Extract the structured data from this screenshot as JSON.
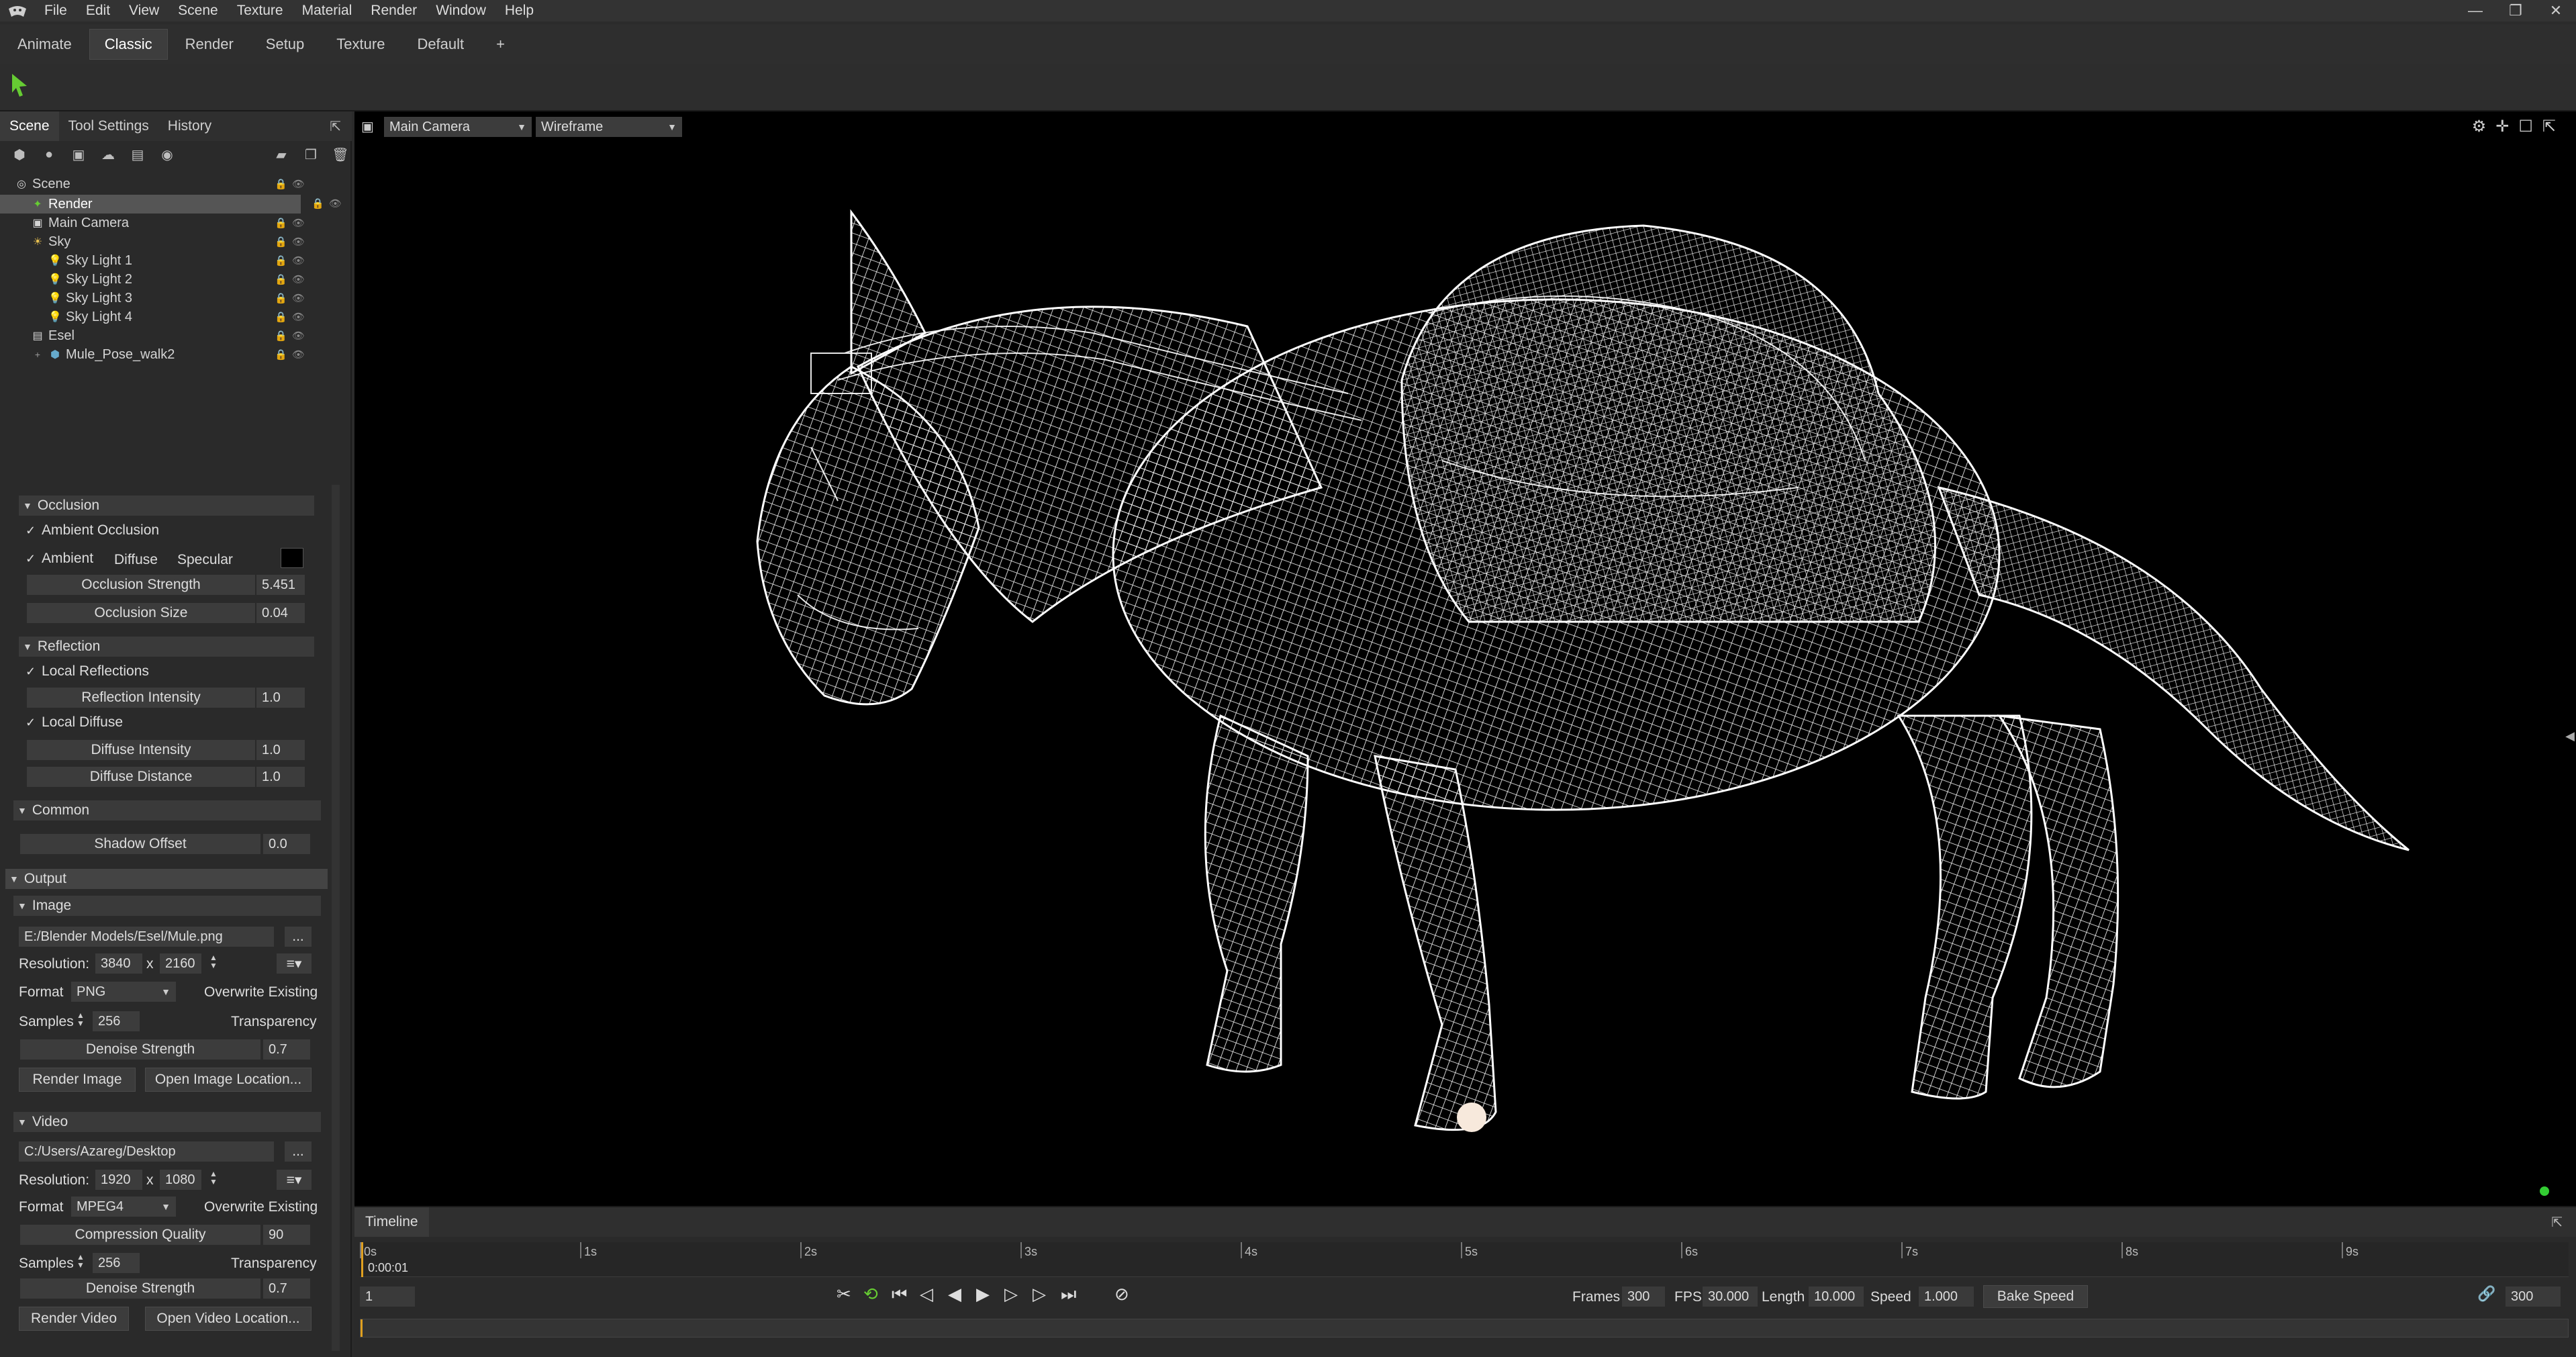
{
  "menubar": {
    "items": [
      "File",
      "Edit",
      "View",
      "Scene",
      "Texture",
      "Material",
      "Render",
      "Window",
      "Help"
    ],
    "window_buttons": [
      "—",
      "❐",
      "✕"
    ]
  },
  "workspace_tabs": [
    "Animate",
    "Classic",
    "Render",
    "Setup",
    "Texture",
    "Default",
    "+"
  ],
  "panel": {
    "tabs": [
      "Scene",
      "Tool Settings",
      "History"
    ]
  },
  "tree": [
    {
      "label": "Scene",
      "icon": "scene-icon"
    },
    {
      "label": "Render",
      "icon": "render-icon",
      "selected": true
    },
    {
      "label": "Main Camera",
      "icon": "camera-icon"
    },
    {
      "label": "Sky",
      "icon": "sky-icon"
    },
    {
      "label": "Sky Light 1",
      "icon": "light-icon"
    },
    {
      "label": "Sky Light 2",
      "icon": "light-icon"
    },
    {
      "label": "Sky Light 3",
      "icon": "light-icon"
    },
    {
      "label": "Sky Light 4",
      "icon": "light-icon"
    },
    {
      "label": "Esel",
      "icon": "group-icon"
    },
    {
      "label": "Mule_Pose_walk2",
      "icon": "mesh-icon"
    }
  ],
  "occlusion": {
    "header": "Occlusion",
    "ambient_occlusion": "Ambient Occlusion",
    "ambient": "Ambient",
    "diffuse": "Diffuse",
    "specular": "Specular",
    "strength_label": "Occlusion Strength",
    "strength_value": "5.451",
    "size_label": "Occlusion Size",
    "size_value": "0.04",
    "color": "#000000"
  },
  "reflection": {
    "header": "Reflection",
    "local_reflections": "Local Reflections",
    "intensity_label": "Reflection Intensity",
    "intensity_value": "1.0",
    "local_diffuse": "Local Diffuse",
    "diffuse_intensity_label": "Diffuse Intensity",
    "diffuse_intensity_value": "1.0",
    "diffuse_distance_label": "Diffuse Distance",
    "diffuse_distance_value": "1.0"
  },
  "common": {
    "header": "Common",
    "shadow_offset_label": "Shadow Offset",
    "shadow_offset_value": "0.0"
  },
  "output": {
    "header": "Output",
    "image": {
      "header": "Image",
      "path": "E:/Blender Models/Esel/Mule.png",
      "browse": "...",
      "resolution_label": "Resolution:",
      "width": "3840",
      "x": "x",
      "height": "2160",
      "format_label": "Format",
      "format": "PNG",
      "overwrite": "Overwrite Existing",
      "samples_label": "Samples",
      "samples": "256",
      "transparency": "Transparency",
      "denoise_label": "Denoise Strength",
      "denoise_value": "0.7",
      "render_button": "Render Image",
      "open_button": "Open Image Location..."
    },
    "video": {
      "header": "Video",
      "path": "C:/Users/Azareg/Desktop",
      "browse": "...",
      "resolution_label": "Resolution:",
      "width": "1920",
      "x": "x",
      "height": "1080",
      "format_label": "Format",
      "format": "MPEG4",
      "overwrite": "Overwrite Existing",
      "quality_label": "Compression Quality",
      "quality_value": "90",
      "samples_label": "Samples",
      "samples": "256",
      "transparency": "Transparency",
      "denoise_label": "Denoise Strength",
      "denoise_value": "0.7",
      "render_button": "Render Video",
      "open_button": "Open Video Location..."
    }
  },
  "viewport": {
    "camera": "Main Camera",
    "shading": "Wireframe"
  },
  "timeline": {
    "title": "Timeline",
    "ticks": [
      "0s",
      "1s",
      "2s",
      "3s",
      "4s",
      "5s",
      "6s",
      "7s",
      "8s",
      "9s"
    ],
    "current_time": "0:00:01",
    "frame_field": "1",
    "frames_label": "Frames",
    "frames_value": "300",
    "fps_label": "FPS",
    "fps_value": "30.000",
    "length_label": "Length",
    "length_value": "10.000",
    "speed_label": "Speed",
    "speed_value": "1.000",
    "bake_button": "Bake Speed",
    "end_frame": "300"
  },
  "colors": {
    "accent_green": "#66cc33",
    "status_dot": "#33cc33"
  }
}
